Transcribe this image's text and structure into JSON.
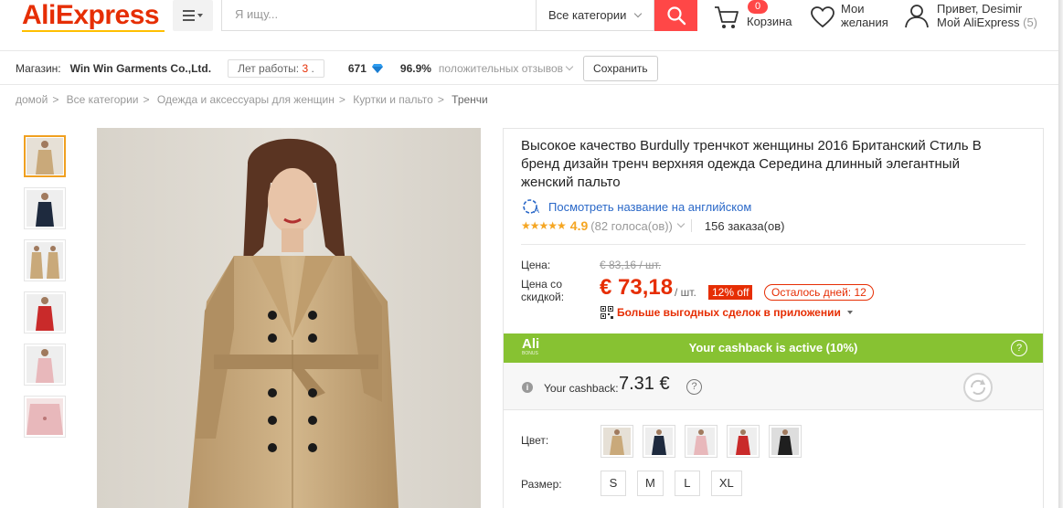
{
  "header": {
    "logo": "AliExpress",
    "search_placeholder": "Я ищу...",
    "category": "Все категории",
    "cart_count": "0",
    "cart_label": "Корзина",
    "wish_line1": "Мои",
    "wish_line2": "желания",
    "account_line1": "Привет, Desimir",
    "account_line2": "Мой AliExpress",
    "account_count": "(5)"
  },
  "store": {
    "label": "Магазин:",
    "name": "Win Win Garments Co.,Ltd.",
    "years_label": "Лет работы:",
    "years_value": "3",
    "score": "671",
    "positive_pct": "96.9%",
    "positive_label": "положительных отзывов",
    "save_label": "Сохранить"
  },
  "breadcrumb": [
    "домой",
    "Все категории",
    "Одежда и аксессуары для женщин",
    "Куртки и пальто",
    "Тренчи"
  ],
  "product": {
    "title": "Высокое качество Burdully тренчкот женщины 2016 Британский Стиль В бренд дизайн тренч верхняя одежда Середина длинный элегантный женский пальто",
    "translate_label": "Посмотреть название на английском",
    "stars": "★★★★★",
    "rating": "4.9",
    "votes": "(82 голоса(ов))",
    "orders": "156 заказа(ов)",
    "price_label": "Цена:",
    "old_price": "€ 83,16 / шт.",
    "discount_label_1": "Цена со",
    "discount_label_2": "скидкой:",
    "new_price": "€ 73,18",
    "per_unit": "/ шт.",
    "off_badge": "12% off",
    "days_left": "Осталось дней: 12",
    "app_deals": "Больше выгодных сделок в приложении",
    "color_label": "Цвет:",
    "size_label": "Размер:",
    "sizes": [
      "S",
      "M",
      "L",
      "XL"
    ]
  },
  "cashback": {
    "logo": "Ali",
    "logo_sub": "BONUS",
    "banner": "Your cashback is active (10%)",
    "your_label": "Your cashback:",
    "value": "7.31 €"
  },
  "colors": {
    "brand": "#e62e04",
    "cashback_green": "#87c232",
    "star": "#f5a623",
    "link": "#2a68c8",
    "coat_beige": "#c9a97a",
    "coat_navy": "#1e2a3e",
    "coat_pink": "#e8b8bb",
    "coat_red": "#c92a2a",
    "coat_black": "#1f1f1f"
  }
}
